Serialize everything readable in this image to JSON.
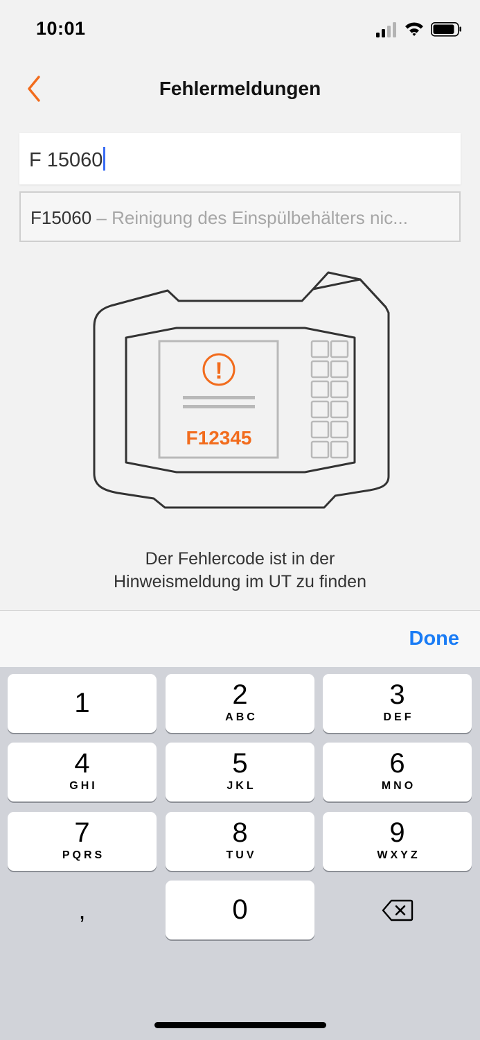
{
  "status_bar": {
    "time": "10:01"
  },
  "nav": {
    "title": "Fehlermeldungen"
  },
  "search": {
    "value": "F 15060"
  },
  "suggestion": {
    "code": "F15060",
    "separator": " – ",
    "description": "Reinigung des Einspülbehälters nic..."
  },
  "illustration": {
    "screen_code": "F12345",
    "warning_glyph": "!"
  },
  "hint": {
    "text": "Der Fehlercode ist in der Hinweismeldung im UT zu finden"
  },
  "keyboard": {
    "done_label": "Done",
    "keys": [
      {
        "num": "1",
        "letters": ""
      },
      {
        "num": "2",
        "letters": "ABC"
      },
      {
        "num": "3",
        "letters": "DEF"
      },
      {
        "num": "4",
        "letters": "GHI"
      },
      {
        "num": "5",
        "letters": "JKL"
      },
      {
        "num": "6",
        "letters": "MNO"
      },
      {
        "num": "7",
        "letters": "PQRS"
      },
      {
        "num": "8",
        "letters": "TUV"
      },
      {
        "num": "9",
        "letters": "WXYZ"
      }
    ],
    "comma": ",",
    "zero": "0",
    "delete_icon": "backspace-icon"
  },
  "colors": {
    "accent": "#f26c1d",
    "link": "#1a7cf5",
    "caret": "#3a6cf4"
  }
}
